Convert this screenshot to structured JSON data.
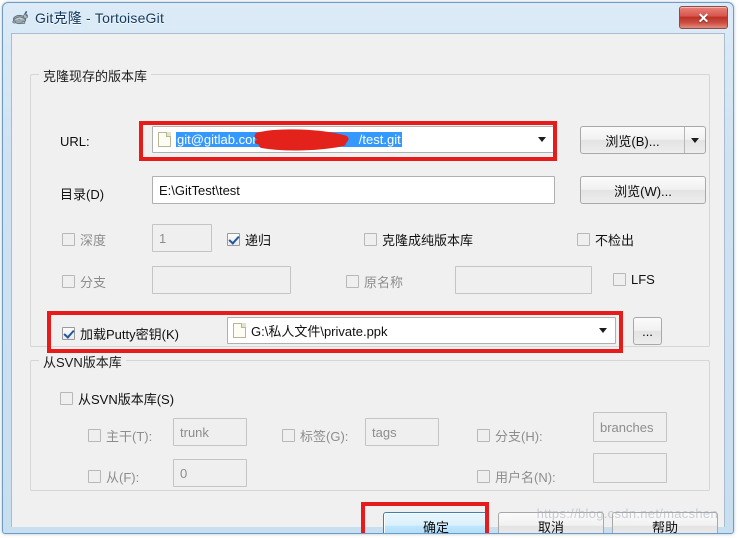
{
  "window": {
    "title": "Git克隆 - TortoiseGit",
    "icon": "tortoisegit-turtle-icon",
    "close_label": "✕"
  },
  "clone_group": {
    "title": "克隆现存的版本库",
    "url_label": "URL:",
    "url_value_prefix": "git@gitlab.com:",
    "url_value_suffix": "/test.git",
    "url_redacted": true,
    "browse_b_label": "浏览(B)...",
    "dir_label": "目录(D)",
    "dir_value": "E:\\GitTest\\test",
    "browse_w_label": "浏览(W)...",
    "depth_label": "深度",
    "depth_checked": false,
    "depth_value": "1",
    "recursive_label": "递归",
    "recursive_checked": true,
    "bare_label": "克隆成纯版本库",
    "bare_checked": false,
    "nocheckout_label": "不检出",
    "nocheckout_checked": false,
    "branch_label": "分支",
    "branch_checked": false,
    "branch_value": "",
    "origin_label": "原名称",
    "origin_checked": false,
    "origin_value": "",
    "lfs_label": "LFS",
    "lfs_checked": false,
    "putty_label": "加载Putty密钥(K)",
    "putty_checked": true,
    "putty_value": "G:\\私人文件\\private.ppk",
    "putty_browse_label": "..."
  },
  "svn_group": {
    "title": "从SVN版本库",
    "from_svn_label": "从SVN版本库(S)",
    "from_svn_checked": false,
    "trunk_label": "主干(T):",
    "trunk_checked": false,
    "trunk_value": "trunk",
    "tags_label": "标签(G):",
    "tags_checked": false,
    "tags_value": "tags",
    "branches_label": "分支(H):",
    "branches_checked": false,
    "branches_value": "branches",
    "from_label": "从(F):",
    "from_checked": false,
    "from_value": "0",
    "username_label": "用户名(N):",
    "username_checked": false,
    "username_value": ""
  },
  "footer": {
    "ok_label": "确定",
    "cancel_label": "取消",
    "help_label": "帮助"
  },
  "watermark": {
    "text": "https://blog.csdn.net/macshen"
  },
  "colors": {
    "annotation_red": "#e81b1b",
    "selection_blue": "#3399ff",
    "default_button_border": "#3c7fb1",
    "title_text": "#14395c"
  }
}
